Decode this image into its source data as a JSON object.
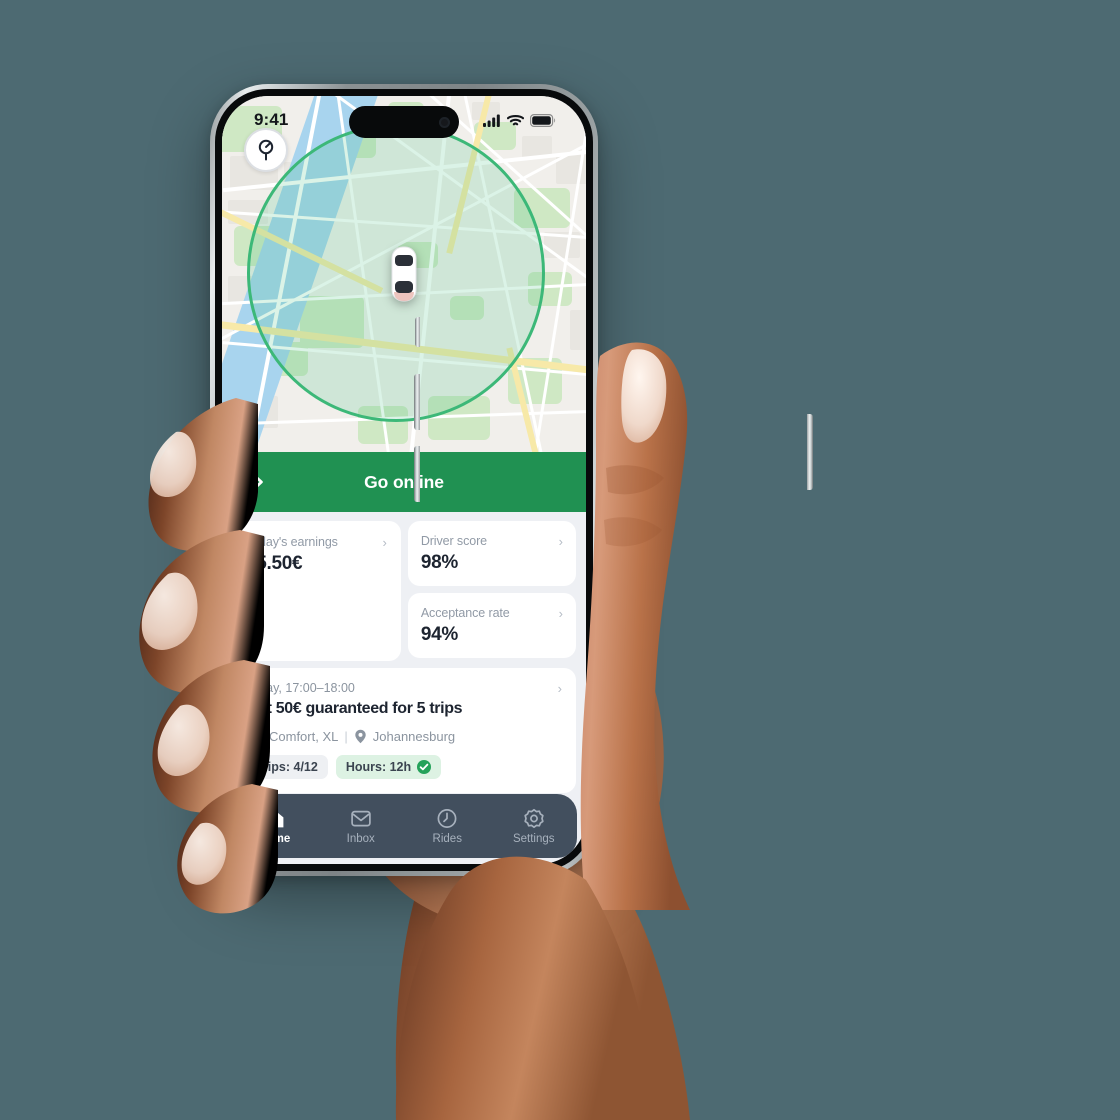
{
  "background_color": "#4d6a72",
  "brand": {
    "green": "#209152",
    "map_circle": "#3cb878",
    "tabbar": "#424f5e",
    "page_bg": "#eef0f4"
  },
  "status_bar": {
    "time": "9:41",
    "icons": [
      "cellular-signal-icon",
      "wifi-icon",
      "battery-icon"
    ]
  },
  "map": {
    "locate_button_icon": "location-pin-icon",
    "vehicle_icon": "car-top-view-icon",
    "geofence_label": ""
  },
  "go_online": {
    "label": "Go online",
    "chevrons_icon": "double-chevron-right-icon"
  },
  "stats": {
    "earnings": {
      "title": "Today's earnings",
      "value": "25.50€",
      "chevron": "›"
    },
    "driver_score": {
      "title": "Driver score",
      "value": "98%",
      "chevron": "›"
    },
    "acceptance_rate": {
      "title": "Acceptance rate",
      "value": "94%",
      "chevron": "›"
    }
  },
  "promo": {
    "time": "Today, 17:00–18:00",
    "chevron": "›",
    "title": "Get 50€ guaranteed for 5 trips",
    "vehicle_icon": "car-icon",
    "vehicle_types": "Comfort, XL",
    "separator": "|",
    "location_icon": "map-pin-icon",
    "location": "Johannesburg",
    "chips": [
      {
        "label": "Trips: 4/12",
        "style": "grey",
        "check": false
      },
      {
        "label": "Hours: 12h",
        "style": "green",
        "check": true
      }
    ]
  },
  "tabbar": {
    "items": [
      {
        "label": "Home",
        "icon": "home-icon",
        "active": true
      },
      {
        "label": "Inbox",
        "icon": "inbox-icon",
        "active": false
      },
      {
        "label": "Rides",
        "icon": "clock-icon",
        "active": false
      },
      {
        "label": "Settings",
        "icon": "gear-icon",
        "active": false
      }
    ]
  }
}
